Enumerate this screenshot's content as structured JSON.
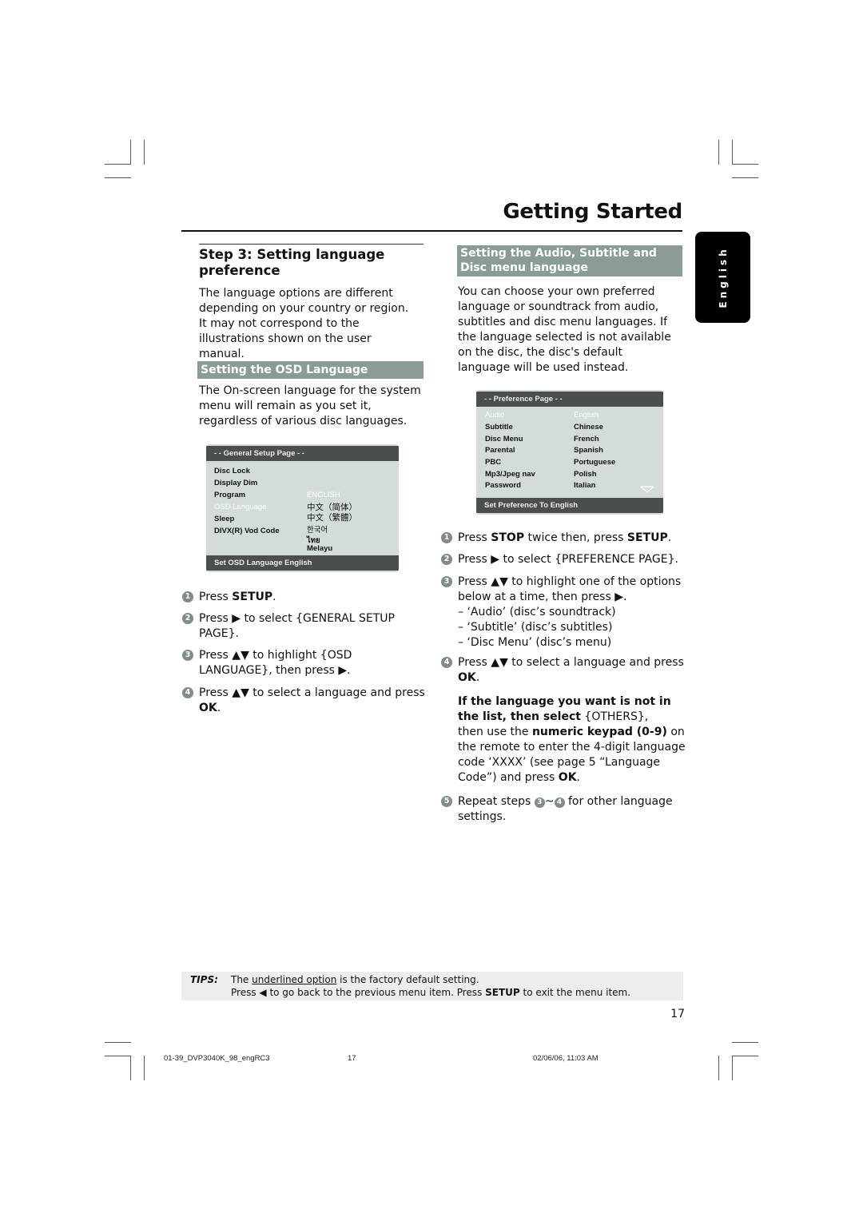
{
  "page": {
    "title": "Getting Started",
    "side_tab": "English",
    "page_number": "17"
  },
  "left": {
    "step_heading": "Step 3:  Setting language preference",
    "intro": "The language options are different depending on your country or region. It may not correspond to the illustrations shown on the user manual.",
    "osd_section": {
      "heading": "Setting the OSD Language",
      "body": "The On-screen language for the system menu will remain as you set it, regardless of various disc languages."
    },
    "osd_menu": {
      "header": "- -   General Setup Page   - -",
      "items": [
        "Disc Lock",
        "Display Dim",
        "Program",
        "OSD Language",
        "Sleep",
        "DIVX(R) Vod Code"
      ],
      "highlighted_item": "OSD Language",
      "options": [
        "ENGLISH",
        "中文（简体）",
        "中文（繁體）",
        "한국어",
        "ไทย",
        "Melayu"
      ],
      "highlighted_option": "ENGLISH",
      "footer": "Set OSD Language English"
    },
    "steps": [
      {
        "num": "1",
        "pre": "Press ",
        "bold": "SETUP",
        "post": "."
      },
      {
        "num": "2",
        "text": "Press ▶ to select {GENERAL SETUP PAGE}."
      },
      {
        "num": "3",
        "text": "Press ▲▼ to highlight {OSD LANGUAGE}, then press ▶."
      },
      {
        "num": "4",
        "pre": "Press ▲▼  to select a language and press ",
        "bold": "OK",
        "post": "."
      }
    ]
  },
  "right": {
    "section_heading": "Setting the Audio, Subtitle and Disc menu language",
    "intro": "You can choose your own preferred language or soundtrack from audio, subtitles and disc menu languages. If the language selected is not available on the disc, the disc's default language will be used instead.",
    "pref_menu": {
      "header": "- -   Preference Page   - -",
      "items": [
        "Audio",
        "Subtitle",
        "Disc Menu",
        "Parental",
        "PBC",
        "Mp3/Jpeg nav",
        "Password"
      ],
      "highlighted_item": "Audio",
      "options": [
        "English",
        "Chinese",
        "French",
        "Spanish",
        "Portuguese",
        "Polish",
        "Italian"
      ],
      "highlighted_option": "English",
      "footer": "Set Preference To English"
    },
    "steps": [
      {
        "num": "1",
        "text": "Press STOP twice then, press SETUP."
      },
      {
        "num": "2",
        "text": "Press ▶ to select {PREFERENCE PAGE}."
      },
      {
        "num": "3",
        "text": "Press ▲▼  to highlight one of the options below at a time, then press ▶.",
        "sub": [
          "–  ‘Audio’ (disc’s soundtrack)",
          "–  ‘Subtitle’ (disc’s subtitles)",
          "–  ‘Disc Menu’ (disc’s menu)"
        ]
      },
      {
        "num": "4",
        "text": "Press ▲▼  to select a language and press OK."
      },
      {
        "num": "5",
        "text": "Repeat steps 3~4 for other language settings."
      }
    ],
    "note": {
      "bold_lead": "If the language you want is not in the list, then select",
      "option": "{OTHERS},",
      "line2_pre": "then use the",
      "line2_bold": "numeric keypad (0-9)",
      "line2_post": "on the remote to enter the 4-digit language code ‘XXXX’ (see page 5 “Language Code”) and press",
      "ok": "OK",
      "end": "."
    }
  },
  "tips": {
    "label": "TIPS:",
    "line1_pre": "The ",
    "line1_underlined": "underlined option",
    "line1_post": " is the factory default setting.",
    "line2_pre": "Press ◀ to go back to the previous menu item. Press ",
    "line2_bold": "SETUP",
    "line2_post": " to exit the menu item."
  },
  "footer": {
    "file": "01-39_DVP3040K_98_engRC3",
    "page": "17",
    "datetime": "02/06/06, 11:03 AM"
  }
}
